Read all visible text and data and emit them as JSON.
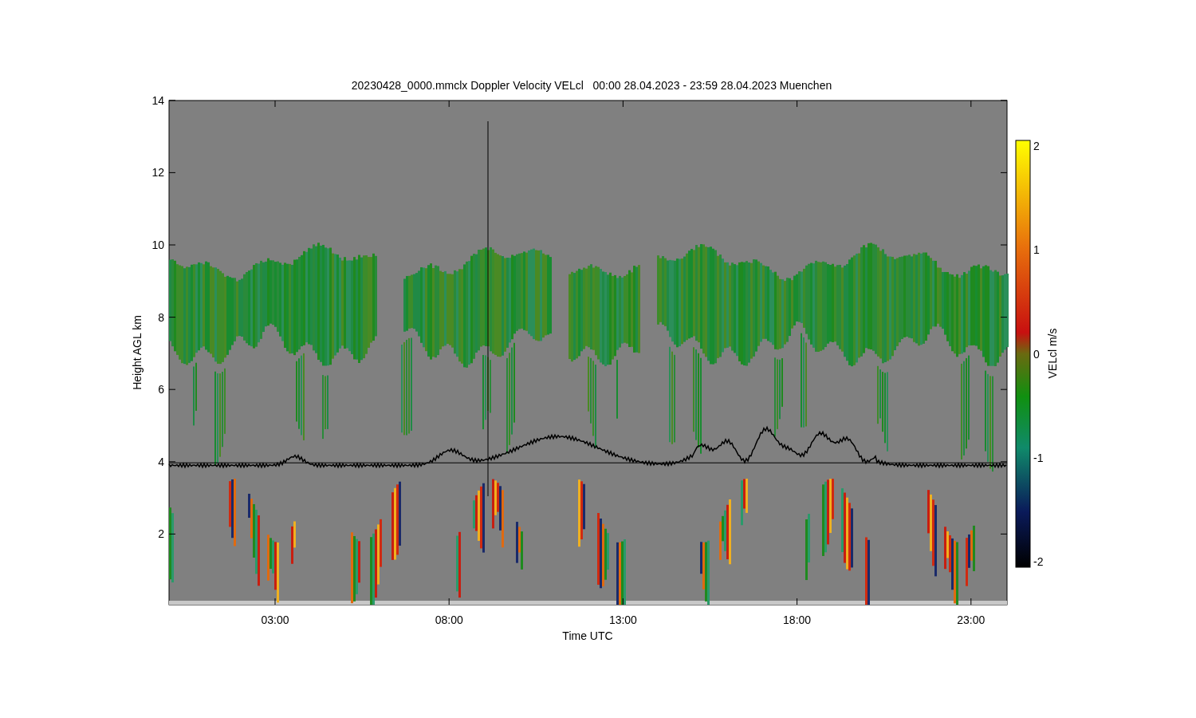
{
  "figure": {
    "title": "20230428_0000.mmclx Doppler Velocity VELcl   00:00 28.04.2023 - 23:59 28.04.2023 Muenchen",
    "y_axis": {
      "label": "Height AGL km",
      "ticks": [
        "14",
        "12",
        "10",
        "8",
        "6",
        "4",
        "2"
      ]
    },
    "x_axis": {
      "label": "Time UTC",
      "ticks": [
        "03:00",
        "08:00",
        "13:00",
        "18:00",
        "23:00"
      ]
    },
    "colorbar": {
      "label": "VELcl m/s",
      "ticks": [
        "2",
        "1",
        "0",
        "-1",
        "-2"
      ]
    }
  }
}
